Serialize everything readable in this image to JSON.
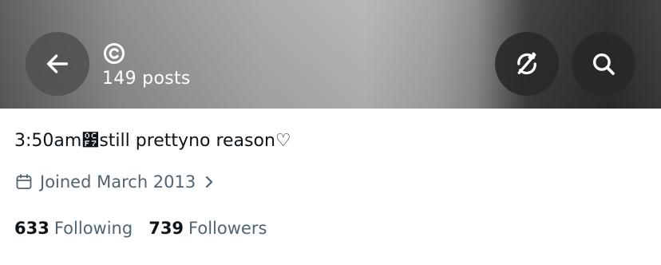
{
  "header": {
    "posts_count": "149 posts",
    "banner_colors": [
      "#5a5a5a",
      "#b5b5b5",
      "#2b2b2b"
    ],
    "buttons": {
      "back_icon": "arrow-left-icon",
      "sync_icon": "no-sync-icon",
      "search_icon": "search-icon"
    },
    "name_icon": "copyright-icon"
  },
  "profile": {
    "bio": "3:50am೷still prettyno reason♡",
    "joined": {
      "icon": "calendar-icon",
      "text": "Joined March 2013",
      "chevron_icon": "chevron-right-icon"
    },
    "stats": {
      "following_count": "633",
      "following_label": "Following",
      "followers_count": "739",
      "followers_label": "Followers"
    }
  },
  "colors": {
    "primary_text": "#0f1419",
    "secondary_text": "#536471"
  }
}
